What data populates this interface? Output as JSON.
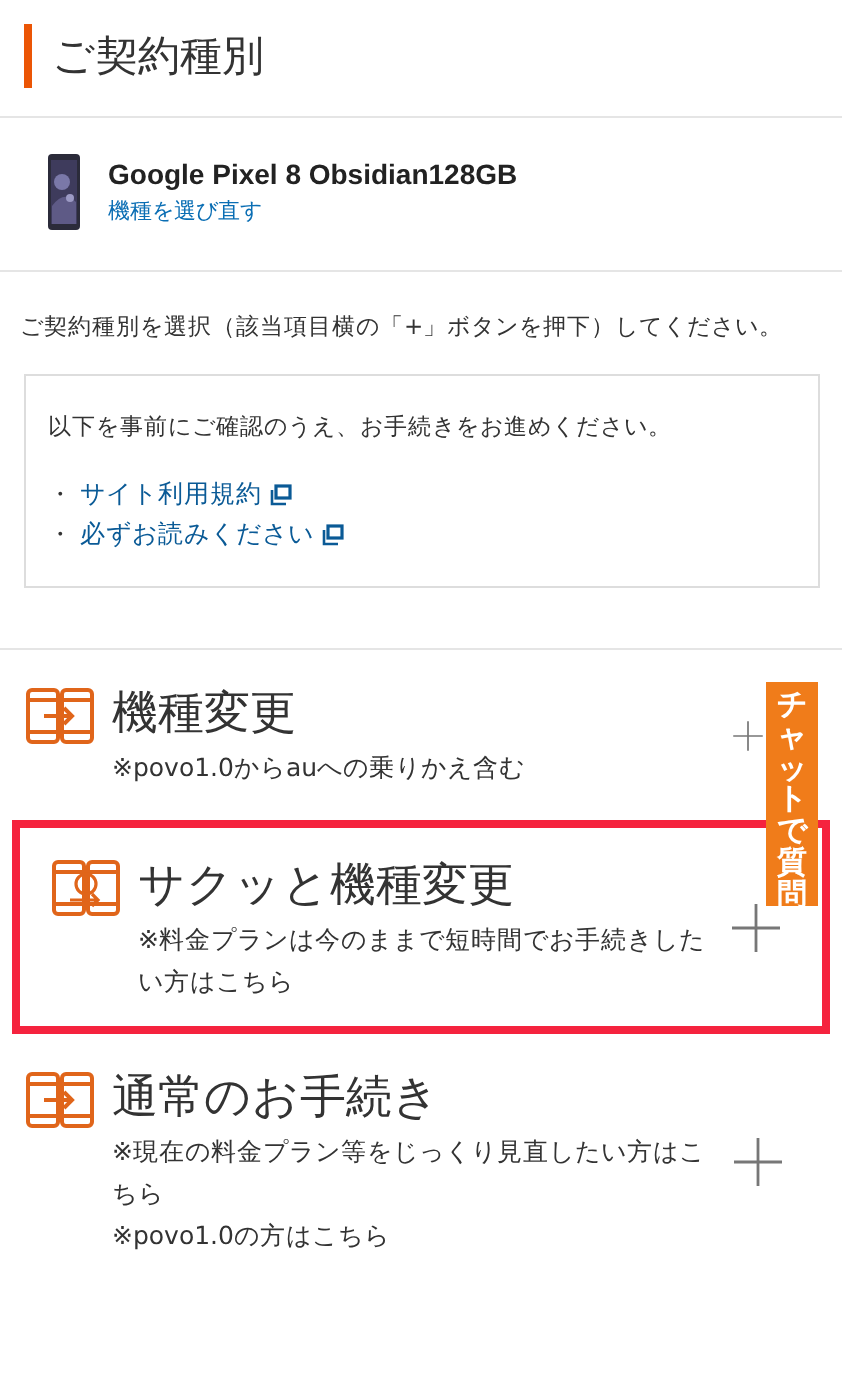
{
  "header": {
    "title": "ご契約種別"
  },
  "device": {
    "name": "Google Pixel 8 Obsidian128GB",
    "reselect_link": "機種を選び直す"
  },
  "instruction": "ご契約種別を選択（該当項目横の「+」ボタンを押下）してください。",
  "notice": {
    "text": "以下を事前にご確認のうえ、お手続きをお進めください。",
    "links": [
      {
        "bullet": "・",
        "label": "サイト利用規約"
      },
      {
        "bullet": "・",
        "label": "必ずお読みください"
      }
    ]
  },
  "options": [
    {
      "kind": "swap",
      "title": "機種変更",
      "notes": [
        "※povo1.0からauへの乗りかえ含む"
      ],
      "highlighted": false
    },
    {
      "kind": "quick",
      "title": "サクッと機種変更",
      "notes": [
        "※料金プランは今のままで短時間でお手続きしたい方はこちら"
      ],
      "highlighted": true
    },
    {
      "kind": "swap",
      "title": "通常のお手続き",
      "notes": [
        "※現在の料金プラン等をじっくり見直したい方はこちら",
        "※povo1.0の方はこちら"
      ],
      "highlighted": false
    }
  ],
  "chat_tab": {
    "label": "チャットで質問"
  }
}
